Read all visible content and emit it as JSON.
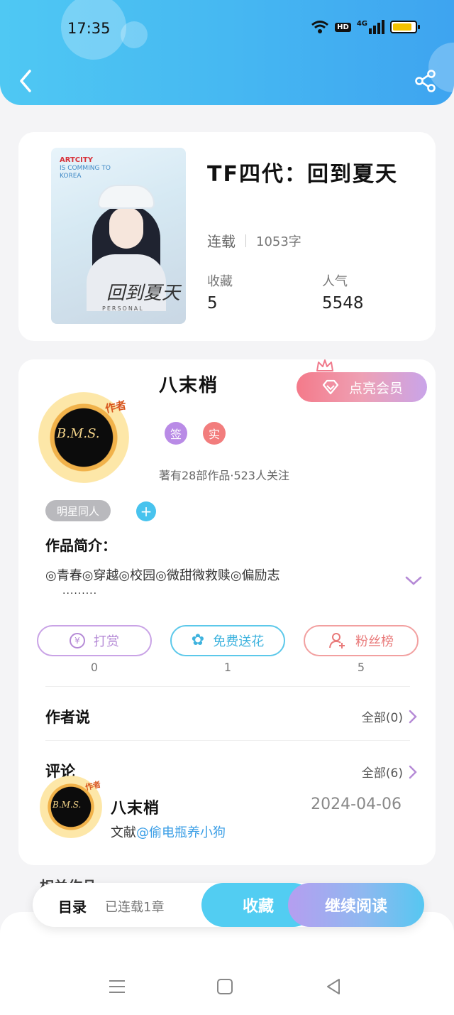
{
  "status_bar": {
    "time": "17:35",
    "network": "4G",
    "hd": "HD"
  },
  "book": {
    "title": "TF四代：回到夏天",
    "status": "连载",
    "word_count": "1053字",
    "favorites_label": "收藏",
    "favorites_value": "5",
    "popularity_label": "人气",
    "popularity_value": "5548",
    "cover": {
      "art_text": "ARTCITY",
      "sub_text": "IS COMMING TO KOREA",
      "calligraphy": "回到夏天",
      "personal": "PERSONAL"
    }
  },
  "author": {
    "name": "八末梢",
    "avatar_tag": "作者",
    "avatar_sig": "B.M.S.",
    "vip_button": "点亮会员",
    "badges": [
      {
        "label": "签",
        "color": "#b98be6"
      },
      {
        "label": "实",
        "color": "#f27d7d"
      }
    ],
    "stats": "著有28部作品·523人关注",
    "genre_tag": "明星同人",
    "plus": "+"
  },
  "intro": {
    "title": "作品简介：",
    "text": "◎青春◎穿越◎校园◎微甜微救赎◎偏励志",
    "dots": "·········"
  },
  "actions": [
    {
      "label": "打赏",
      "count": "0",
      "color": "#c9a3e6",
      "text_color": "#b58ad6",
      "icon": "yen-coin-icon",
      "glyph": "¥"
    },
    {
      "label": "免费送花",
      "count": "1",
      "color": "#5cc8ea",
      "text_color": "#3fb3de",
      "icon": "flower-icon",
      "glyph": "✿"
    },
    {
      "label": "粉丝榜",
      "count": "5",
      "color": "#f2a0a0",
      "text_color": "#e97a7a",
      "icon": "fan-rank-icon",
      "glyph": "♚"
    }
  ],
  "author_says": {
    "title": "作者说",
    "more": "全部(0)"
  },
  "comments": {
    "title": "评论",
    "more": "全部(6)",
    "items": [
      {
        "name": "八末梢",
        "date": "2024-04-06",
        "prefix": "文献",
        "mention": "@偷电瓶养小狗"
      }
    ]
  },
  "peek": "相关作品",
  "bottom_bar": {
    "toc_label": "目录",
    "toc_status": "已连载1章",
    "favorite_button": "收藏",
    "continue_button": "继续阅读"
  },
  "nav": [
    "menu-icon",
    "home-square-icon",
    "back-triangle-icon"
  ]
}
